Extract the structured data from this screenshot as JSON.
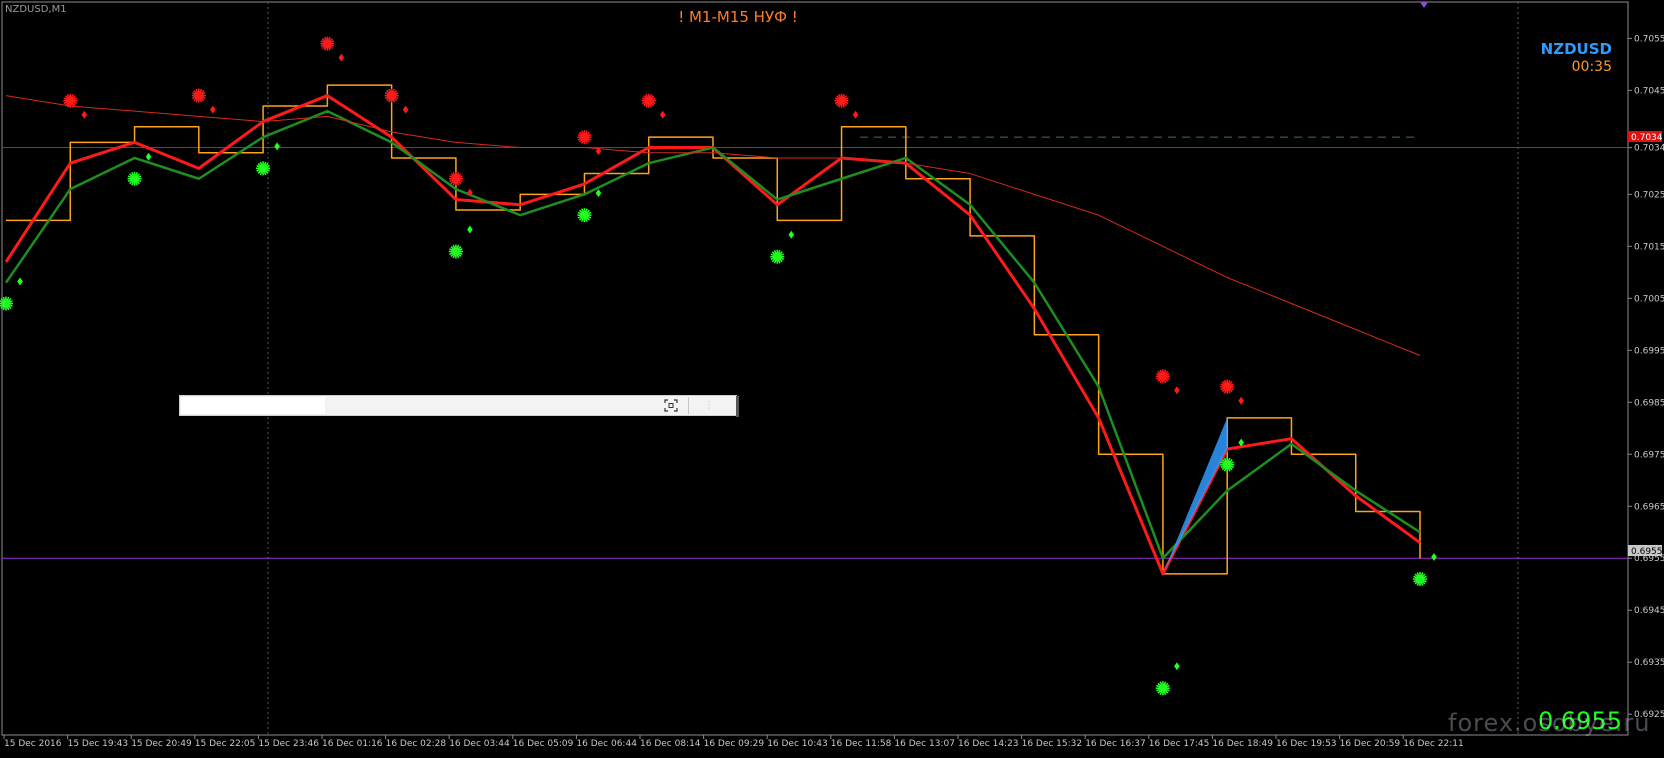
{
  "window": {
    "symbol_title": "NZDUSD,M1",
    "banner_text": "! M1-M15 НУФ !",
    "symbol_big": "NZDUSD",
    "candle_timer": "00:35",
    "bid_big": "0.6955",
    "watermark": "forex.osobye.ru"
  },
  "colors": {
    "background": "#000000",
    "axis": "#9a9a9a",
    "fast_line": "#ff1a1a",
    "slow_line": "#1e8f1e",
    "step_line_up": "#2f9bff",
    "step_line_down": "#ffa41a",
    "long_ma": "#d42a1a",
    "price_line": "#e01010",
    "bid_line": "#9b2fd6",
    "buy_signal": "#22ff22",
    "sell_signal": "#ff1a1a"
  },
  "price_axis": {
    "ticks": [
      "0.7055",
      "0.7045",
      "0.7034",
      "0.7025",
      "0.7015",
      "0.7005",
      "0.6995",
      "0.6985",
      "0.6975",
      "0.6965",
      "0.6955",
      "0.6945",
      "0.6935",
      "0.6925"
    ],
    "price_line_tag": "0.7034",
    "bid_line_tag": "0.6955"
  },
  "time_axis": {
    "ticks": [
      "15 Dec 2016",
      "15 Dec 19:43",
      "15 Dec 20:49",
      "15 Dec 22:05",
      "15 Dec 23:46",
      "16 Dec 01:16",
      "16 Dec 02:28",
      "16 Dec 03:44",
      "16 Dec 05:09",
      "16 Dec 06:44",
      "16 Dec 08:14",
      "16 Dec 09:29",
      "16 Dec 10:43",
      "16 Dec 11:58",
      "16 Dec 13:07",
      "16 Dec 14:23",
      "16 Dec 15:32",
      "16 Dec 16:37",
      "16 Dec 17:45",
      "16 Dec 18:49",
      "16 Dec 19:53",
      "16 Dec 20:59",
      "16 Dec 22:11"
    ]
  },
  "overlay": {
    "input_value": "",
    "expand_icon": "expand-icon",
    "extra_label": "⋮"
  },
  "chart_data": {
    "type": "line",
    "symbol": "NZDUSD",
    "timeframe": "M1",
    "ylim": [
      0.6921,
      0.7062
    ],
    "yticks": [
      0.7055,
      0.7045,
      0.7034,
      0.7025,
      0.7015,
      0.7005,
      0.6995,
      0.6985,
      0.6975,
      0.6965,
      0.6955,
      0.6945,
      0.6935,
      0.6925
    ],
    "categories": [
      "15 Dec 2016",
      "15 Dec 19:43",
      "15 Dec 20:49",
      "15 Dec 22:05",
      "15 Dec 23:46",
      "16 Dec 01:16",
      "16 Dec 02:28",
      "16 Dec 03:44",
      "16 Dec 05:09",
      "16 Dec 06:44",
      "16 Dec 08:14",
      "16 Dec 09:29",
      "16 Dec 10:43",
      "16 Dec 11:58",
      "16 Dec 13:07",
      "16 Dec 14:23",
      "16 Dec 15:32",
      "16 Dec 16:37",
      "16 Dec 17:45",
      "16 Dec 18:49",
      "16 Dec 19:53",
      "16 Dec 20:59",
      "16 Dec 22:11"
    ],
    "series": [
      {
        "values": [
          0.702,
          0.7035,
          0.7038,
          0.7033,
          0.7042,
          0.7046,
          0.7032,
          0.7022,
          0.7025,
          0.7029,
          0.7036,
          0.7032,
          0.702,
          0.7038,
          0.7028,
          0.7017,
          0.6998,
          0.6975,
          0.6952,
          0.6982,
          0.6975,
          0.6964,
          0.6955
        ]
      },
      {
        "values": [
          0.7012,
          0.7031,
          0.7035,
          0.703,
          0.7039,
          0.7044,
          0.7036,
          0.7024,
          0.7023,
          0.7027,
          0.7034,
          0.7034,
          0.7023,
          0.7032,
          0.7031,
          0.7021,
          0.7003,
          0.6982,
          0.6952,
          0.6976,
          0.6978,
          0.6967,
          0.6958
        ]
      },
      {
        "values": [
          0.7008,
          0.7026,
          0.7032,
          0.7028,
          0.7036,
          0.7041,
          0.7035,
          0.7026,
          0.7021,
          0.7025,
          0.7031,
          0.7034,
          0.7024,
          0.7028,
          0.7032,
          0.7023,
          0.7008,
          0.6988,
          0.6955,
          0.6968,
          0.6977,
          0.6968,
          0.696
        ]
      },
      {
        "values": [
          0.7044,
          0.7042,
          0.7041,
          0.704,
          0.7039,
          0.704,
          0.7037,
          0.7035,
          0.7034,
          0.7034,
          0.7033,
          0.7033,
          0.7032,
          0.7032,
          0.7031,
          0.7029,
          0.7025,
          0.7021,
          0.7015,
          0.7009,
          0.7004,
          0.6999,
          0.6994
        ]
      }
    ],
    "horizontal_lines": [
      {
        "value": 0.7034
      },
      {
        "value": 0.6955
      },
      {
        "value": 0.7036
      }
    ],
    "buy_signals": [
      {
        "x": "15 Dec 2016",
        "y": 0.7004
      },
      {
        "x": "15 Dec 20:49",
        "y": 0.7028
      },
      {
        "x": "15 Dec 23:46",
        "y": 0.703
      },
      {
        "x": "16 Dec 03:44",
        "y": 0.7014
      },
      {
        "x": "16 Dec 06:44",
        "y": 0.7021
      },
      {
        "x": "16 Dec 10:43",
        "y": 0.7013
      },
      {
        "x": "16 Dec 17:45",
        "y": 0.693
      },
      {
        "x": "16 Dec 18:49",
        "y": 0.6973
      },
      {
        "x": "16 Dec 22:11",
        "y": 0.6951
      }
    ],
    "sell_signals": [
      {
        "x": "15 Dec 19:43",
        "y": 0.7043
      },
      {
        "x": "15 Dec 22:05",
        "y": 0.7044
      },
      {
        "x": "16 Dec 01:16",
        "y": 0.7054
      },
      {
        "x": "16 Dec 02:28",
        "y": 0.7044
      },
      {
        "x": "16 Dec 03:44",
        "y": 0.7028
      },
      {
        "x": "16 Dec 06:44",
        "y": 0.7036
      },
      {
        "x": "16 Dec 08:14",
        "y": 0.7043
      },
      {
        "x": "16 Dec 11:58",
        "y": 0.7043
      },
      {
        "x": "16 Dec 17:45",
        "y": 0.699
      },
      {
        "x": "16 Dec 18:49",
        "y": 0.6988
      }
    ]
  }
}
